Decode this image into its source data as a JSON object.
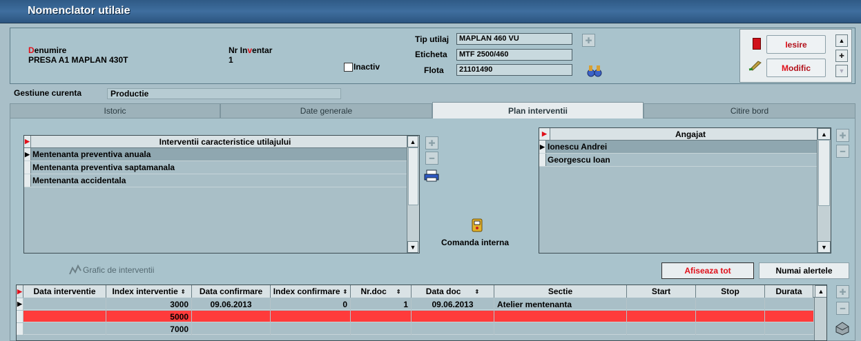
{
  "window": {
    "title": "Nomenclator utilaie"
  },
  "header": {
    "denumire_label_first": "D",
    "denumire_label_rest": "enumire",
    "denumire_value": "PRESA A1 MAPLAN 430T",
    "nr_inventar_label_a": "Nr In",
    "nr_inventar_label_b": "v",
    "nr_inventar_label_c": "entar",
    "nr_inventar_value": "1",
    "inactiv_label": "Inactiv",
    "tip_utilaj_label": "Tip utilaj",
    "tip_utilaj_value": "MAPLAN 460 VU",
    "eticheta_label": "Eticheta",
    "eticheta_value": "MTF 2500/460",
    "flota_label": "Flota",
    "flota_value": "21101490"
  },
  "commands": {
    "iesire_first": "I",
    "iesire_rest": "esire",
    "modific_first": "M",
    "modific_rest": "odific"
  },
  "gestiune": {
    "label": "Gestiune curenta",
    "value": "Productie"
  },
  "tabs": [
    {
      "label": "Istoric"
    },
    {
      "label": "Date generale"
    },
    {
      "label": "Plan interventii"
    },
    {
      "label": "Citire bord"
    }
  ],
  "interventii": {
    "header": "Interventii caracteristice utilajului",
    "rows": [
      "Mentenanta preventiva anuala",
      "Mentenanta preventiva saptamanala",
      "Mentenanta accidentala"
    ]
  },
  "angajat": {
    "header": "Angajat",
    "rows": [
      "Ionescu  Andrei",
      "Georgescu Ioan"
    ]
  },
  "comanda_interna_label": "Comanda interna",
  "grafic_label": "Grafic de interventii",
  "filters": {
    "afiseaza_tot": "Afiseaza tot",
    "numai_alertele": "Numai alertele"
  },
  "plan_table": {
    "columns": [
      "Data interventie",
      "Index interventie",
      "Data confirmare",
      "Index confirmare",
      "Nr.doc",
      "Data doc",
      "Sectie",
      "Start",
      "Stop",
      "Durata"
    ],
    "rows": [
      {
        "data_interventie": "",
        "index_interventie": "3000",
        "data_confirmare": "09.06.2013",
        "index_confirmare": "0",
        "nr_doc": "1",
        "data_doc": "09.06.2013",
        "sectie": "Atelier mentenanta",
        "start": "",
        "stop": "",
        "durata": ""
      },
      {
        "data_interventie": "",
        "index_interventie": "5000",
        "data_confirmare": "",
        "index_confirmare": "",
        "nr_doc": "",
        "data_doc": "",
        "sectie": "",
        "start": "",
        "stop": "",
        "durata": ""
      },
      {
        "data_interventie": "",
        "index_interventie": "7000",
        "data_confirmare": "",
        "index_confirmare": "",
        "nr_doc": "",
        "data_doc": "",
        "sectie": "",
        "start": "",
        "stop": "",
        "durata": ""
      }
    ]
  },
  "colors": {
    "alert_row": "#ff3b3b",
    "accent_red": "#e0101a",
    "title_bar": "#3f6e9e"
  }
}
